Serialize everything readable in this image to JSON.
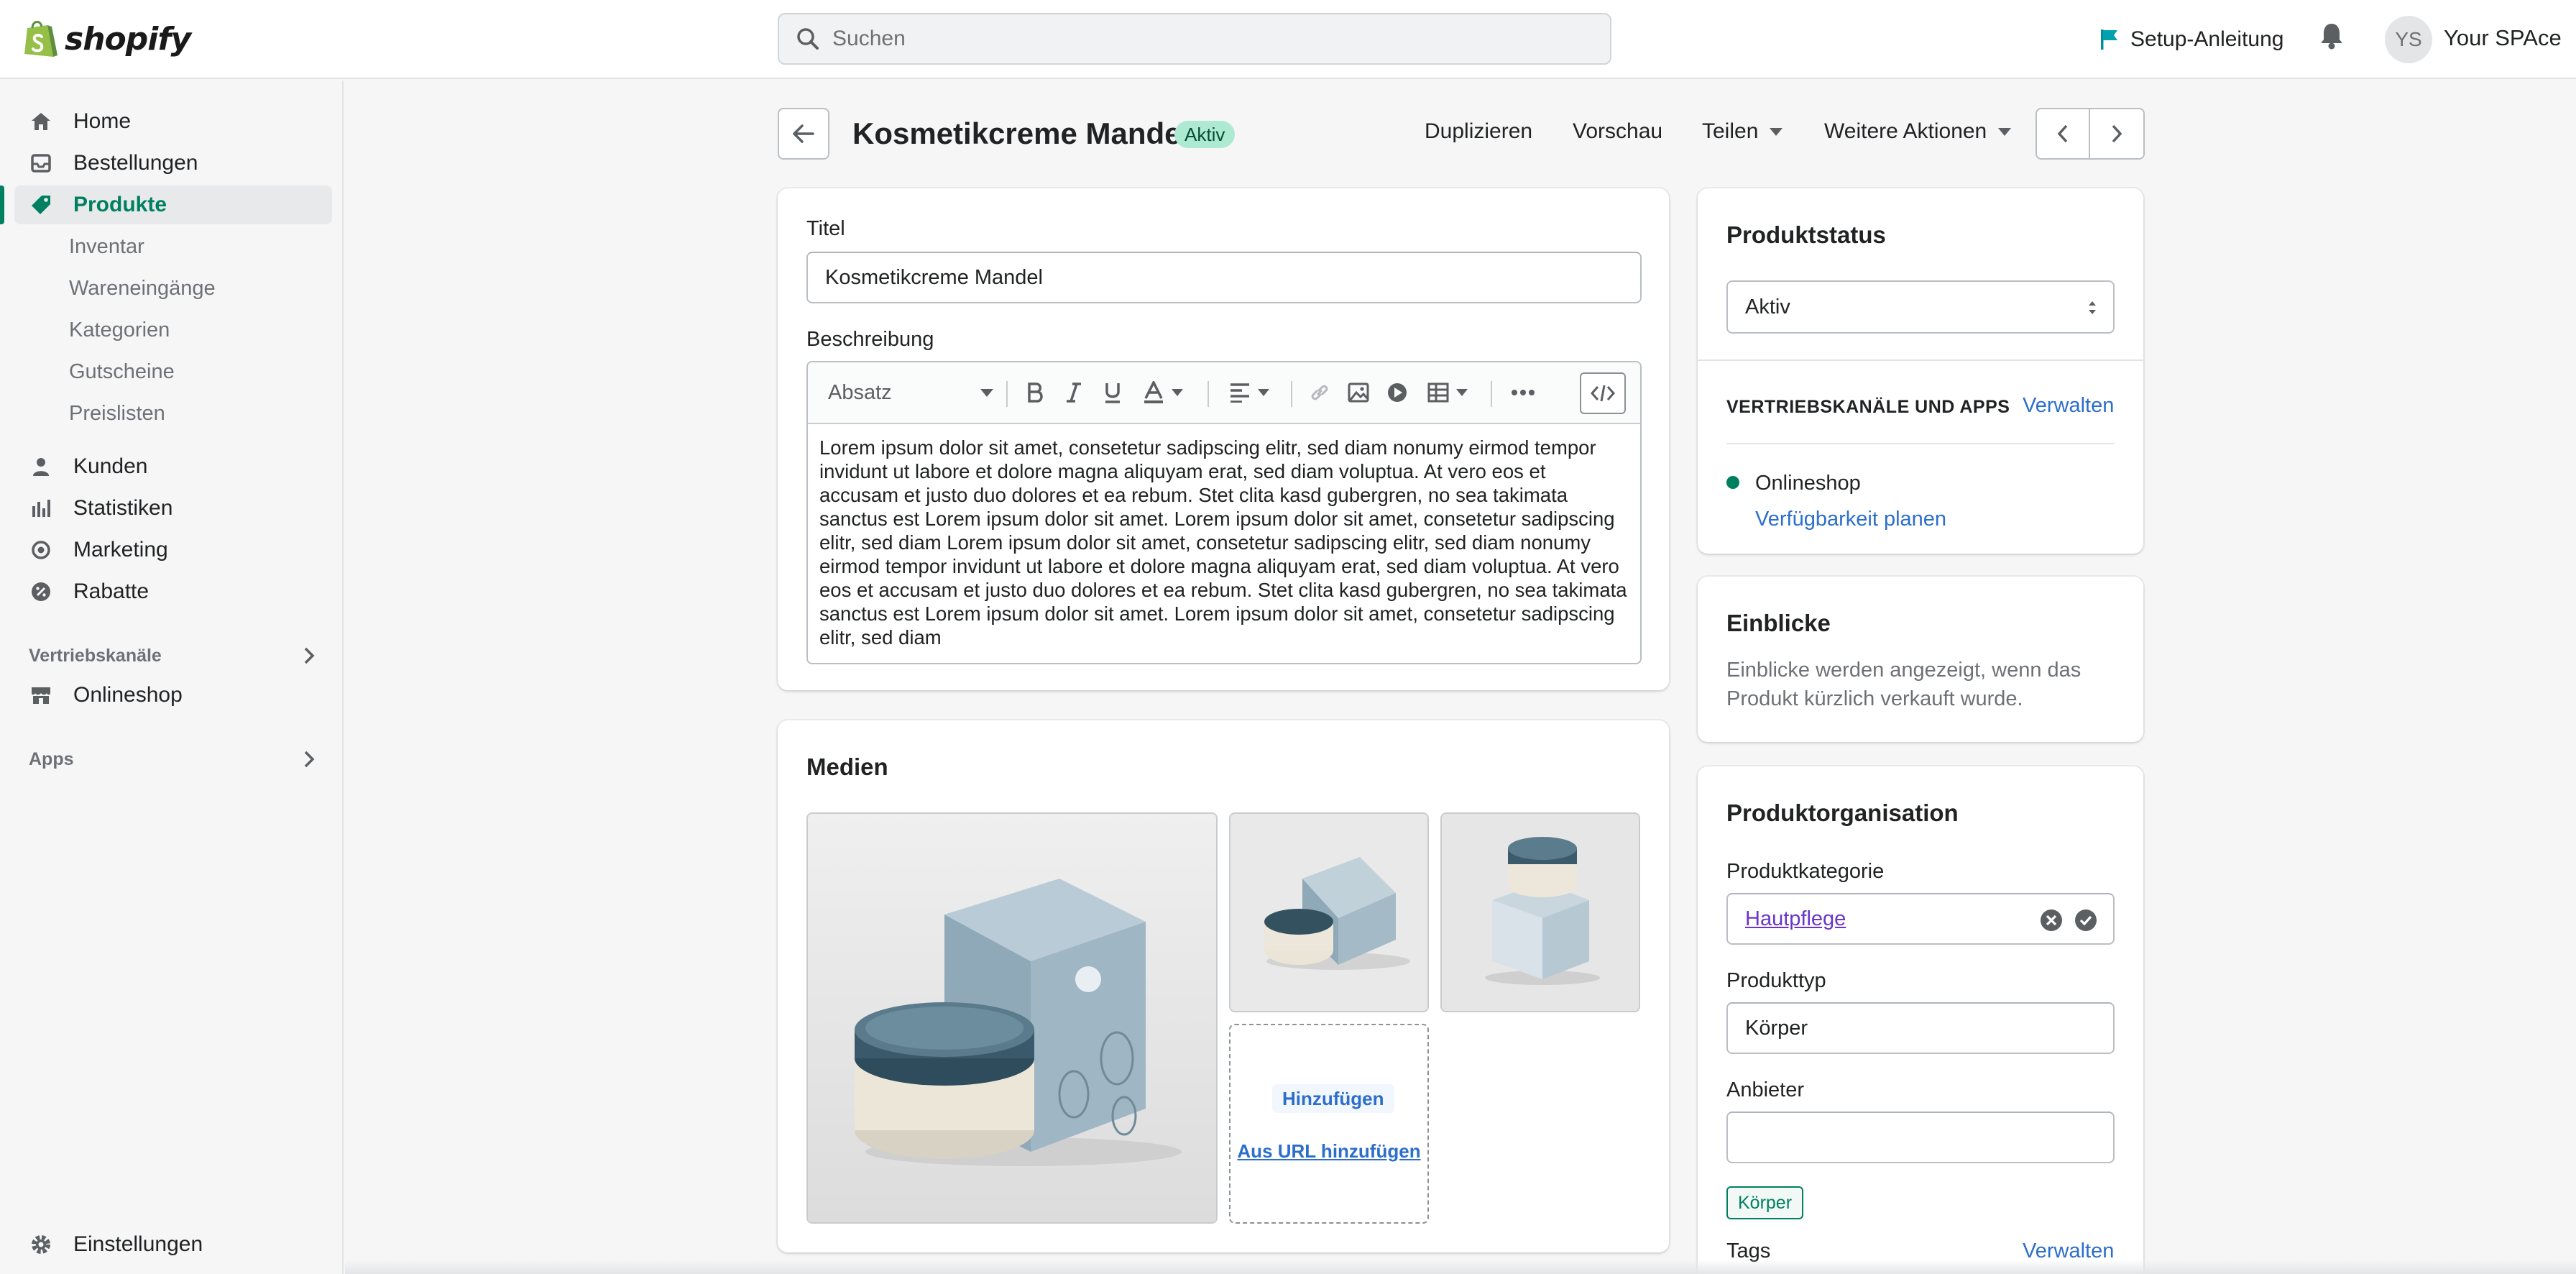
{
  "app": {
    "brand": "shopify"
  },
  "topbar": {
    "search_placeholder": "Suchen",
    "setup_label": "Setup-Anleitung",
    "avatar_initials": "YS",
    "store_name": "Your SPAce"
  },
  "sidebar": {
    "items": [
      {
        "label": "Home",
        "icon": "home-icon"
      },
      {
        "label": "Bestellungen",
        "icon": "orders-icon"
      },
      {
        "label": "Produkte",
        "icon": "tag-icon",
        "active": true
      },
      {
        "label": "Kunden",
        "icon": "person-icon"
      },
      {
        "label": "Statistiken",
        "icon": "bar-chart-icon"
      },
      {
        "label": "Marketing",
        "icon": "target-icon"
      },
      {
        "label": "Rabatte",
        "icon": "discount-icon"
      }
    ],
    "product_subitems": [
      "Inventar",
      "Wareneingänge",
      "Kategorien",
      "Gutscheine",
      "Preislisten"
    ],
    "sales_channels_label": "Vertriebskanäle",
    "onlineshop_label": "Onlineshop",
    "apps_label": "Apps",
    "settings_label": "Einstellungen"
  },
  "header": {
    "title": "Kosmetikcreme Mandel",
    "status": "Aktiv",
    "duplicate": "Duplizieren",
    "preview": "Vorschau",
    "share": "Teilen",
    "more_actions": "Weitere Aktionen"
  },
  "product": {
    "title_label": "Titel",
    "title_value": "Kosmetikcreme Mandel",
    "description_label": "Beschreibung",
    "paragraph_format": "Absatz",
    "description_text": "Lorem ipsum dolor sit amet, consetetur sadipscing elitr, sed diam nonumy eirmod tempor invidunt ut labore et dolore magna aliquyam erat, sed diam voluptua. At vero eos et accusam et justo duo dolores et ea rebum. Stet clita kasd gubergren, no sea takimata sanctus est Lorem ipsum dolor sit amet. Lorem ipsum dolor sit amet, consetetur sadipscing elitr, sed diam Lorem ipsum dolor sit amet, consetetur sadipscing elitr, sed diam nonumy eirmod tempor invidunt ut labore et dolore magna aliquyam erat, sed diam voluptua. At vero eos et accusam et justo duo dolores et ea rebum. Stet clita kasd gubergren, no sea takimata sanctus est Lorem ipsum dolor sit amet. Lorem ipsum dolor sit amet, consetetur sadipscing elitr, sed diam"
  },
  "media": {
    "title": "Medien",
    "add_button": "Hinzufügen",
    "add_from_url": "Aus URL hinzufügen"
  },
  "status_card": {
    "title": "Produktstatus",
    "selected": "Aktiv",
    "channels_heading": "VERTRIEBSKANÄLE UND APPS",
    "manage": "Verwalten",
    "channel_name": "Onlineshop",
    "schedule": "Verfügbarkeit planen"
  },
  "insights": {
    "title": "Einblicke",
    "text": "Einblicke werden angezeigt, wenn das Produkt kürzlich verkauft wurde."
  },
  "organization": {
    "title": "Produktorganisation",
    "category_label": "Produktkategorie",
    "category_value": "Hautpflege",
    "type_label": "Produkttyp",
    "type_value": "Körper",
    "vendor_label": "Anbieter",
    "vendor_value": "",
    "type_chip": "Körper",
    "tags_label": "Tags",
    "tags_manage": "Verwalten"
  },
  "colors": {
    "accent": "#008060",
    "link": "#2c6ecb",
    "success_bg": "#aee9d1"
  }
}
